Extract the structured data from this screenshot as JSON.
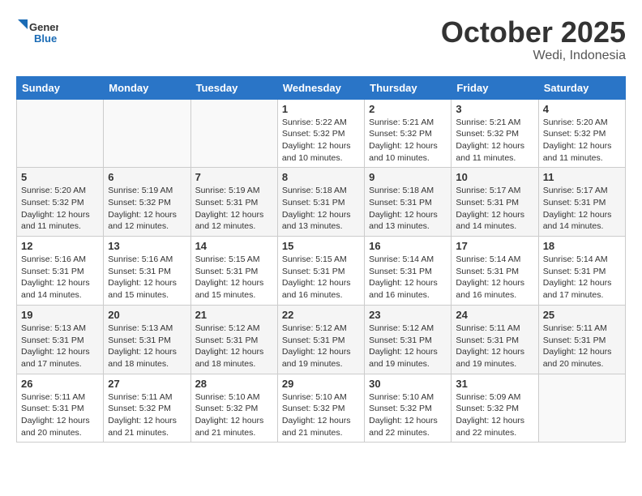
{
  "header": {
    "logo_general": "General",
    "logo_blue": "Blue",
    "month": "October 2025",
    "location": "Wedi, Indonesia"
  },
  "days_of_week": [
    "Sunday",
    "Monday",
    "Tuesday",
    "Wednesday",
    "Thursday",
    "Friday",
    "Saturday"
  ],
  "weeks": [
    [
      {
        "day": "",
        "info": ""
      },
      {
        "day": "",
        "info": ""
      },
      {
        "day": "",
        "info": ""
      },
      {
        "day": "1",
        "info": "Sunrise: 5:22 AM\nSunset: 5:32 PM\nDaylight: 12 hours\nand 10 minutes."
      },
      {
        "day": "2",
        "info": "Sunrise: 5:21 AM\nSunset: 5:32 PM\nDaylight: 12 hours\nand 10 minutes."
      },
      {
        "day": "3",
        "info": "Sunrise: 5:21 AM\nSunset: 5:32 PM\nDaylight: 12 hours\nand 11 minutes."
      },
      {
        "day": "4",
        "info": "Sunrise: 5:20 AM\nSunset: 5:32 PM\nDaylight: 12 hours\nand 11 minutes."
      }
    ],
    [
      {
        "day": "5",
        "info": "Sunrise: 5:20 AM\nSunset: 5:32 PM\nDaylight: 12 hours\nand 11 minutes."
      },
      {
        "day": "6",
        "info": "Sunrise: 5:19 AM\nSunset: 5:32 PM\nDaylight: 12 hours\nand 12 minutes."
      },
      {
        "day": "7",
        "info": "Sunrise: 5:19 AM\nSunset: 5:31 PM\nDaylight: 12 hours\nand 12 minutes."
      },
      {
        "day": "8",
        "info": "Sunrise: 5:18 AM\nSunset: 5:31 PM\nDaylight: 12 hours\nand 13 minutes."
      },
      {
        "day": "9",
        "info": "Sunrise: 5:18 AM\nSunset: 5:31 PM\nDaylight: 12 hours\nand 13 minutes."
      },
      {
        "day": "10",
        "info": "Sunrise: 5:17 AM\nSunset: 5:31 PM\nDaylight: 12 hours\nand 14 minutes."
      },
      {
        "day": "11",
        "info": "Sunrise: 5:17 AM\nSunset: 5:31 PM\nDaylight: 12 hours\nand 14 minutes."
      }
    ],
    [
      {
        "day": "12",
        "info": "Sunrise: 5:16 AM\nSunset: 5:31 PM\nDaylight: 12 hours\nand 14 minutes."
      },
      {
        "day": "13",
        "info": "Sunrise: 5:16 AM\nSunset: 5:31 PM\nDaylight: 12 hours\nand 15 minutes."
      },
      {
        "day": "14",
        "info": "Sunrise: 5:15 AM\nSunset: 5:31 PM\nDaylight: 12 hours\nand 15 minutes."
      },
      {
        "day": "15",
        "info": "Sunrise: 5:15 AM\nSunset: 5:31 PM\nDaylight: 12 hours\nand 16 minutes."
      },
      {
        "day": "16",
        "info": "Sunrise: 5:14 AM\nSunset: 5:31 PM\nDaylight: 12 hours\nand 16 minutes."
      },
      {
        "day": "17",
        "info": "Sunrise: 5:14 AM\nSunset: 5:31 PM\nDaylight: 12 hours\nand 16 minutes."
      },
      {
        "day": "18",
        "info": "Sunrise: 5:14 AM\nSunset: 5:31 PM\nDaylight: 12 hours\nand 17 minutes."
      }
    ],
    [
      {
        "day": "19",
        "info": "Sunrise: 5:13 AM\nSunset: 5:31 PM\nDaylight: 12 hours\nand 17 minutes."
      },
      {
        "day": "20",
        "info": "Sunrise: 5:13 AM\nSunset: 5:31 PM\nDaylight: 12 hours\nand 18 minutes."
      },
      {
        "day": "21",
        "info": "Sunrise: 5:12 AM\nSunset: 5:31 PM\nDaylight: 12 hours\nand 18 minutes."
      },
      {
        "day": "22",
        "info": "Sunrise: 5:12 AM\nSunset: 5:31 PM\nDaylight: 12 hours\nand 19 minutes."
      },
      {
        "day": "23",
        "info": "Sunrise: 5:12 AM\nSunset: 5:31 PM\nDaylight: 12 hours\nand 19 minutes."
      },
      {
        "day": "24",
        "info": "Sunrise: 5:11 AM\nSunset: 5:31 PM\nDaylight: 12 hours\nand 19 minutes."
      },
      {
        "day": "25",
        "info": "Sunrise: 5:11 AM\nSunset: 5:31 PM\nDaylight: 12 hours\nand 20 minutes."
      }
    ],
    [
      {
        "day": "26",
        "info": "Sunrise: 5:11 AM\nSunset: 5:31 PM\nDaylight: 12 hours\nand 20 minutes."
      },
      {
        "day": "27",
        "info": "Sunrise: 5:11 AM\nSunset: 5:32 PM\nDaylight: 12 hours\nand 21 minutes."
      },
      {
        "day": "28",
        "info": "Sunrise: 5:10 AM\nSunset: 5:32 PM\nDaylight: 12 hours\nand 21 minutes."
      },
      {
        "day": "29",
        "info": "Sunrise: 5:10 AM\nSunset: 5:32 PM\nDaylight: 12 hours\nand 21 minutes."
      },
      {
        "day": "30",
        "info": "Sunrise: 5:10 AM\nSunset: 5:32 PM\nDaylight: 12 hours\nand 22 minutes."
      },
      {
        "day": "31",
        "info": "Sunrise: 5:09 AM\nSunset: 5:32 PM\nDaylight: 12 hours\nand 22 minutes."
      },
      {
        "day": "",
        "info": ""
      }
    ]
  ]
}
